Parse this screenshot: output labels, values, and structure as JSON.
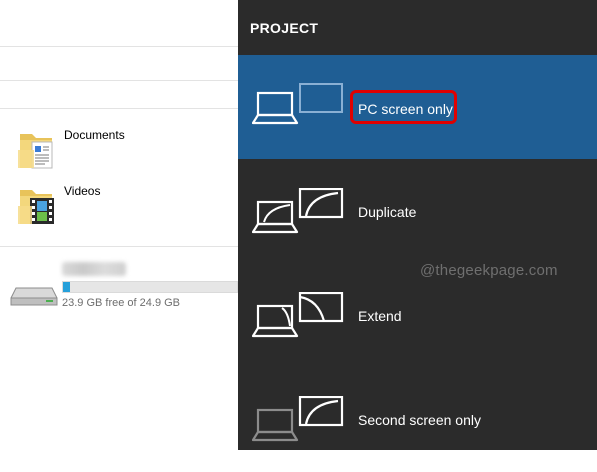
{
  "explorer": {
    "folders": [
      {
        "label": "Documents",
        "icon": "documents-folder-icon"
      },
      {
        "label": "Videos",
        "icon": "videos-folder-icon"
      }
    ],
    "drive": {
      "free_text": "23.9 GB free of 24.9 GB",
      "used_fraction": 0.04,
      "icon": "hard-drive-icon"
    }
  },
  "project": {
    "title": "PROJECT",
    "options": [
      {
        "label": "PC screen only",
        "selected": true,
        "icon": "pc-screen-only-icon"
      },
      {
        "label": "Duplicate",
        "selected": false,
        "icon": "duplicate-icon"
      },
      {
        "label": "Extend",
        "selected": false,
        "icon": "extend-icon"
      },
      {
        "label": "Second screen only",
        "selected": false,
        "icon": "second-screen-only-icon"
      }
    ],
    "watermark": "@thegeekpage.com"
  },
  "colors": {
    "panel_bg": "#2b2b2b",
    "selected_bg": "#1f5e94",
    "highlight_border": "#e00000",
    "progress_fill": "#26a0da"
  }
}
